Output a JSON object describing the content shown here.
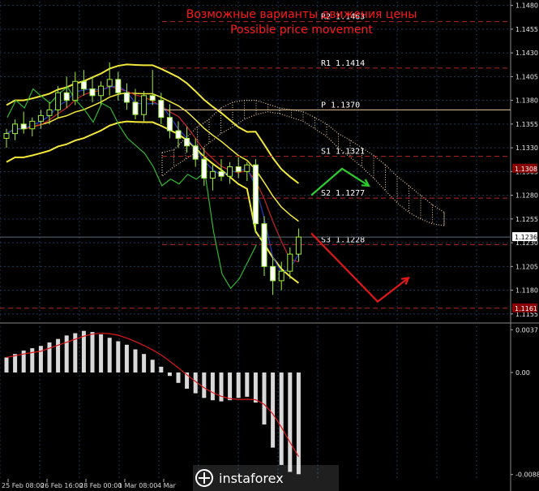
{
  "chart_data": {
    "type": "candlestick",
    "title": "Возможные варианты движения цены",
    "subtitle": "Possible price movement",
    "price_ticks": [
      "1.1480",
      "1.1455",
      "1.1430",
      "1.1405",
      "1.1380",
      "1.1355",
      "1.1330",
      "1.1305",
      "1.1280",
      "1.1255",
      "1.1230",
      "1.1205",
      "1.1180",
      "1.1155"
    ],
    "price_range": [
      1.1148,
      1.1484
    ],
    "current_price": "1.1236",
    "tags": [
      {
        "label": "1.1308",
        "value": 1.1308,
        "bg": "#8b0000"
      },
      {
        "label": "1.1161",
        "value": 1.1161,
        "bg": "#8b0000"
      }
    ],
    "levels": [
      {
        "label": "R2",
        "value": "1.1463",
        "v": 1.1463
      },
      {
        "label": "R1",
        "value": "1.1414",
        "v": 1.1414
      },
      {
        "label": "P",
        "value": "1.1370",
        "v": 1.137
      },
      {
        "label": "S1",
        "value": "1.1321",
        "v": 1.1321
      },
      {
        "label": "S2",
        "value": "1.1277",
        "v": 1.1277
      },
      {
        "label": "S3",
        "value": "1.1228",
        "v": 1.1228
      }
    ],
    "time_labels": [
      "25 Feb 08:00",
      "26 Feb 16:00",
      "28 Feb 00:00",
      "1 Mar 08:00",
      "4 Mar"
    ],
    "candles": [
      [
        1.134,
        1.135,
        1.133,
        1.1345
      ],
      [
        1.1345,
        1.136,
        1.1338,
        1.1355
      ],
      [
        1.1355,
        1.1368,
        1.1345,
        1.135
      ],
      [
        1.135,
        1.1362,
        1.1342,
        1.1358
      ],
      [
        1.1358,
        1.137,
        1.135,
        1.1364
      ],
      [
        1.1364,
        1.1378,
        1.1355,
        1.137
      ],
      [
        1.137,
        1.1395,
        1.1362,
        1.1388
      ],
      [
        1.1388,
        1.1405,
        1.1372,
        1.138
      ],
      [
        1.138,
        1.141,
        1.1375,
        1.14
      ],
      [
        1.14,
        1.1412,
        1.1385,
        1.1392
      ],
      [
        1.1392,
        1.1405,
        1.1378,
        1.1385
      ],
      [
        1.1385,
        1.14,
        1.1375,
        1.1395
      ],
      [
        1.1395,
        1.142,
        1.1385,
        1.1402
      ],
      [
        1.1402,
        1.141,
        1.138,
        1.1388
      ],
      [
        1.1388,
        1.1398,
        1.137,
        1.1378
      ],
      [
        1.1378,
        1.1392,
        1.136,
        1.1365
      ],
      [
        1.1365,
        1.139,
        1.1358,
        1.1385
      ],
      [
        1.1385,
        1.1412,
        1.1375,
        1.138
      ],
      [
        1.138,
        1.1388,
        1.1355,
        1.1362
      ],
      [
        1.1362,
        1.1376,
        1.134,
        1.1348
      ],
      [
        1.1348,
        1.1358,
        1.133,
        1.134
      ],
      [
        1.134,
        1.1352,
        1.1325,
        1.1332
      ],
      [
        1.1332,
        1.134,
        1.131,
        1.1318
      ],
      [
        1.1318,
        1.133,
        1.129,
        1.1298
      ],
      [
        1.1298,
        1.1312,
        1.1285,
        1.1305
      ],
      [
        1.1305,
        1.1318,
        1.1295,
        1.13
      ],
      [
        1.13,
        1.1315,
        1.1292,
        1.131
      ],
      [
        1.131,
        1.132,
        1.1298,
        1.1305
      ],
      [
        1.1305,
        1.1315,
        1.1295,
        1.1312
      ],
      [
        1.1312,
        1.1318,
        1.124,
        1.125
      ],
      [
        1.125,
        1.1258,
        1.1195,
        1.1205
      ],
      [
        1.1205,
        1.1215,
        1.1175,
        1.119
      ],
      [
        1.119,
        1.121,
        1.118,
        1.12
      ],
      [
        1.12,
        1.1225,
        1.1192,
        1.1218
      ],
      [
        1.1218,
        1.1245,
        1.121,
        1.1236
      ]
    ],
    "forecast": {
      "up": [
        [
          1.128
        ],
        [
          1.1308
        ],
        [
          1.129
        ]
      ],
      "down": [
        [
          1.124
        ],
        [
          1.1168
        ],
        [
          1.1193
        ]
      ]
    },
    "macd_ticks": [
      "0.0037",
      "0.00",
      "-0.00883"
    ],
    "macd_range": [
      -0.0092,
      0.004
    ],
    "histogram": [
      0.0013,
      0.0016,
      0.0019,
      0.0021,
      0.0023,
      0.0026,
      0.0029,
      0.0032,
      0.0034,
      0.0036,
      0.0035,
      0.0033,
      0.003,
      0.0027,
      0.0024,
      0.002,
      0.0016,
      0.0011,
      0.0005,
      -0.0003,
      -0.0009,
      -0.0014,
      -0.0018,
      -0.0022,
      -0.0024,
      -0.0025,
      -0.0024,
      -0.0022,
      -0.0021,
      -0.0026,
      -0.0045,
      -0.0065,
      -0.008,
      -0.0086,
      -0.0088
    ]
  },
  "branding": {
    "logo_text": "instaforex"
  }
}
